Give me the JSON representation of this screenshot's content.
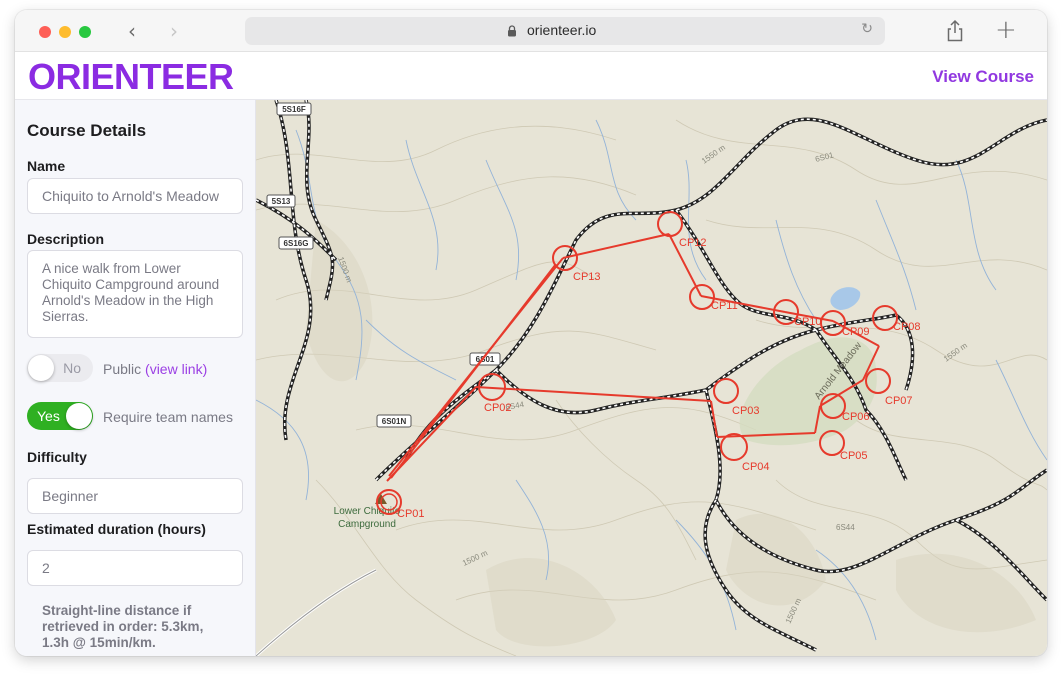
{
  "browser": {
    "url": "orienteer.io",
    "back_icon": "‹",
    "forward_icon": "›",
    "reload_icon": "↻",
    "new_tab_icon": "+"
  },
  "header": {
    "logo": "ORIENTEER",
    "view_course": "View Course"
  },
  "sidebar": {
    "title": "Course Details",
    "name_label": "Name",
    "name_value": "Chiquito to Arnold's Meadow",
    "description_label": "Description",
    "description_value": "A nice walk from Lower Chiquito Campground around Arnold's Meadow in the High Sierras.",
    "public_toggle": {
      "state": "No",
      "on": false
    },
    "public_caption": "Public",
    "public_link": "(view link)",
    "team_toggle": {
      "state": "Yes",
      "on": true
    },
    "team_caption": "Require team names",
    "difficulty_label": "Difficulty",
    "difficulty_value": "Beginner",
    "duration_label": "Estimated duration (hours)",
    "duration_value": "2",
    "distance_note": "Straight-line distance if retrieved in order: 5.3km, 1.3h @ 15min/km."
  },
  "map": {
    "course_color": "#e63a2c",
    "place_labels": {
      "campground": [
        "Lower Chiquito",
        "Campground"
      ],
      "meadow": "Arnold Meadow"
    },
    "road_labels": [
      "5S16F",
      "5S13",
      "6S16G",
      "6S01",
      "6S01N",
      "6S44",
      "6S01",
      "6S44"
    ],
    "terrain_labels": [
      "1550 m",
      "1500 m",
      "1550 m",
      "1500 m",
      "1500 m"
    ],
    "checkpoints": [
      {
        "label": "CP01"
      },
      {
        "label": "CP02"
      },
      {
        "label": "CP03"
      },
      {
        "label": "CP04"
      },
      {
        "label": "CP05"
      },
      {
        "label": "CP06"
      },
      {
        "label": "CP07"
      },
      {
        "label": "CP08"
      },
      {
        "label": "CP09"
      },
      {
        "label": "CP10"
      },
      {
        "label": "CP11"
      },
      {
        "label": "CP12"
      },
      {
        "label": "CP13"
      }
    ]
  }
}
